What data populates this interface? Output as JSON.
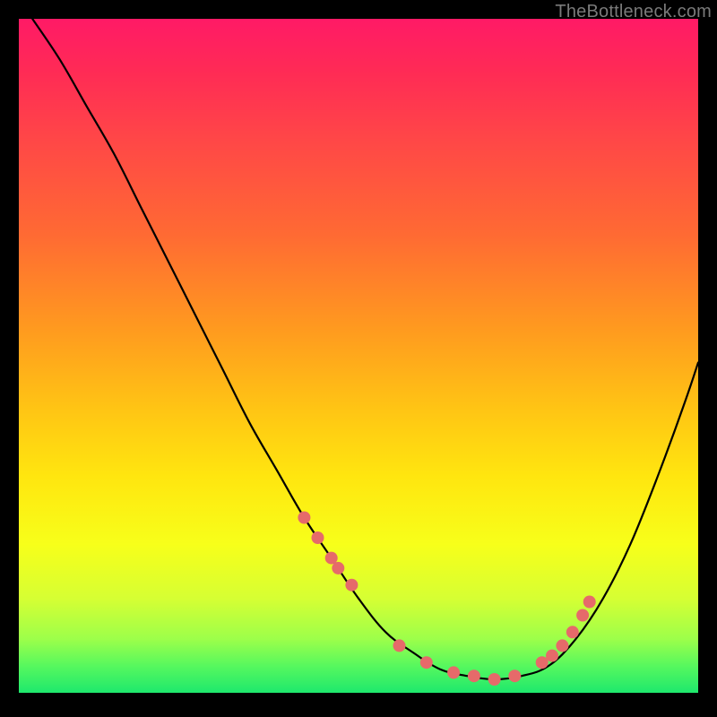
{
  "watermark": "TheBottleneck.com",
  "chart_data": {
    "type": "line",
    "title": "",
    "xlabel": "",
    "ylabel": "",
    "xlim": [
      0,
      100
    ],
    "ylim": [
      0,
      100
    ],
    "grid": false,
    "legend": false,
    "series": [
      {
        "name": "bottleneck-curve",
        "x": [
          2,
          6,
          10,
          14,
          18,
          22,
          26,
          30,
          34,
          38,
          42,
          46,
          50,
          54,
          58,
          62,
          66,
          70,
          74,
          78,
          82,
          86,
          90,
          94,
          98,
          100
        ],
        "y": [
          100,
          94,
          87,
          80,
          72,
          64,
          56,
          48,
          40,
          33,
          26,
          20,
          14,
          9,
          6,
          3.5,
          2.5,
          2,
          2.5,
          4,
          8,
          14,
          22,
          32,
          43,
          49
        ]
      }
    ],
    "markers": {
      "name": "highlight-dots",
      "color": "#e66a6a",
      "radius_px": 7,
      "x": [
        42,
        44,
        46,
        47,
        49,
        56,
        60,
        64,
        67,
        70,
        73,
        77,
        78.5,
        80,
        81.5,
        83,
        84
      ],
      "y": [
        26,
        23,
        20,
        18.5,
        16,
        7,
        4.5,
        3,
        2.5,
        2,
        2.5,
        4.5,
        5.5,
        7,
        9,
        11.5,
        13.5
      ]
    },
    "background_gradient": {
      "direction": "vertical",
      "stops": [
        {
          "pos": 0.0,
          "color": "#ff1a66"
        },
        {
          "pos": 0.18,
          "color": "#ff4747"
        },
        {
          "pos": 0.46,
          "color": "#ff9a1f"
        },
        {
          "pos": 0.68,
          "color": "#ffe60f"
        },
        {
          "pos": 0.86,
          "color": "#d6ff33"
        },
        {
          "pos": 1.0,
          "color": "#1ee86d"
        }
      ]
    }
  }
}
